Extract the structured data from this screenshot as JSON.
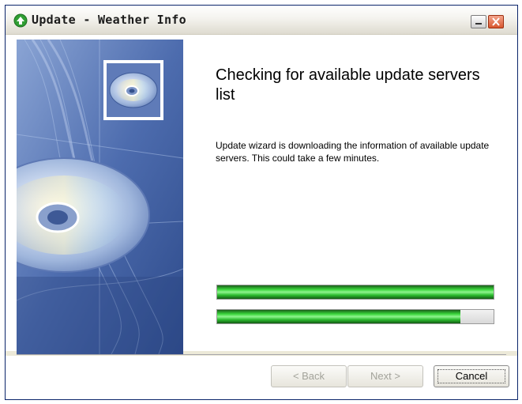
{
  "window": {
    "title": "Update - Weather Info",
    "minimize_icon": "minimize-icon",
    "close_icon": "close-icon",
    "app_icon": "update-arrow-icon"
  },
  "main": {
    "heading": "Checking for available update servers list",
    "description": "Update wizard is downloading the information of available update servers. This could take a few minutes.",
    "side_image": "cd-disc-illustration"
  },
  "progress": {
    "bars": [
      {
        "value": 1.0
      },
      {
        "value": 0.88
      }
    ],
    "color": "#2fcf31"
  },
  "buttons": {
    "back_label": "< Back",
    "next_label": "Next >",
    "cancel_label": "Cancel"
  }
}
